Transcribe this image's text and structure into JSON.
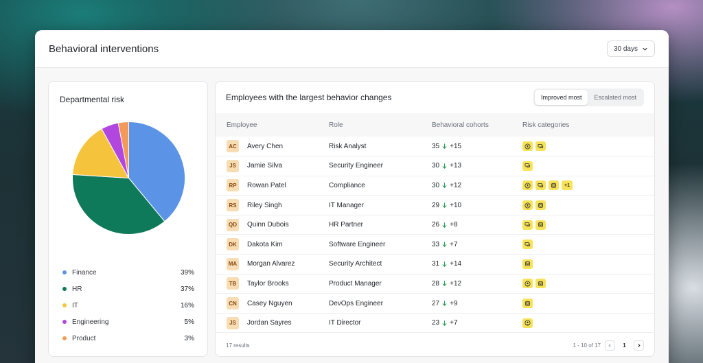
{
  "header": {
    "title": "Behavioral interventions",
    "range": "30 days"
  },
  "risk_panel": {
    "title": "Departmental risk",
    "departments": [
      {
        "name": "Finance",
        "pct_label": "39%",
        "value": 39,
        "color": "#5b93e6"
      },
      {
        "name": "HR",
        "pct_label": "37%",
        "value": 37,
        "color": "#0f7a5a"
      },
      {
        "name": "IT",
        "pct_label": "16%",
        "value": 16,
        "color": "#f6c43c"
      },
      {
        "name": "Engineering",
        "pct_label": "5%",
        "value": 5,
        "color": "#b247e0"
      },
      {
        "name": "Product",
        "pct_label": "3%",
        "value": 3,
        "color": "#f29a5a"
      }
    ]
  },
  "employees_panel": {
    "title": "Employees with the largest behavior changes",
    "tabs": [
      {
        "label": "Improved most",
        "active": true
      },
      {
        "label": "Escalated most",
        "active": false
      }
    ],
    "columns": {
      "employee": "Employee",
      "role": "Role",
      "cohorts": "Behavioral cohorts",
      "risk": "Risk categories"
    },
    "rows": [
      {
        "initials": "AC",
        "name": "Avery Chen",
        "role": "Risk Analyst",
        "cohort": "35",
        "change": "+15",
        "risks": [
          "person-icon",
          "chat-icon"
        ]
      },
      {
        "initials": "JS",
        "name": "Jamie Silva",
        "role": "Security Engineer",
        "cohort": "30",
        "change": "+13",
        "risks": [
          "chat-icon"
        ]
      },
      {
        "initials": "RP",
        "name": "Rowan Patel",
        "role": "Compliance",
        "cohort": "30",
        "change": "+12",
        "risks": [
          "person-icon",
          "chat-icon",
          "database-icon"
        ],
        "extra": "+1"
      },
      {
        "initials": "RS",
        "name": "Riley Singh",
        "role": "IT Manager",
        "cohort": "29",
        "change": "+10",
        "risks": [
          "person-icon",
          "database-icon"
        ]
      },
      {
        "initials": "QD",
        "name": "Quinn Dubois",
        "role": "HR Partner",
        "cohort": "26",
        "change": "+8",
        "risks": [
          "chat-icon",
          "database-icon"
        ]
      },
      {
        "initials": "DK",
        "name": "Dakota Kim",
        "role": "Software Engineer",
        "cohort": "33",
        "change": "+7",
        "risks": [
          "chat-icon"
        ]
      },
      {
        "initials": "MA",
        "name": "Morgan Alvarez",
        "role": "Security Architect",
        "cohort": "31",
        "change": "+14",
        "risks": [
          "database-icon"
        ]
      },
      {
        "initials": "TB",
        "name": "Taylor Brooks",
        "role": "Product Manager",
        "cohort": "28",
        "change": "+12",
        "risks": [
          "person-icon",
          "database-icon"
        ]
      },
      {
        "initials": "CN",
        "name": "Casey Nguyen",
        "role": "DevOps Engineer",
        "cohort": "27",
        "change": "+9",
        "risks": [
          "database-icon"
        ]
      },
      {
        "initials": "JS",
        "name": "Jordan Sayres",
        "role": "IT Director",
        "cohort": "23",
        "change": "+7",
        "risks": [
          "person-icon"
        ]
      }
    ],
    "footer": {
      "results": "17 results",
      "range": "1 - 10 of 17",
      "page": "1"
    }
  }
}
